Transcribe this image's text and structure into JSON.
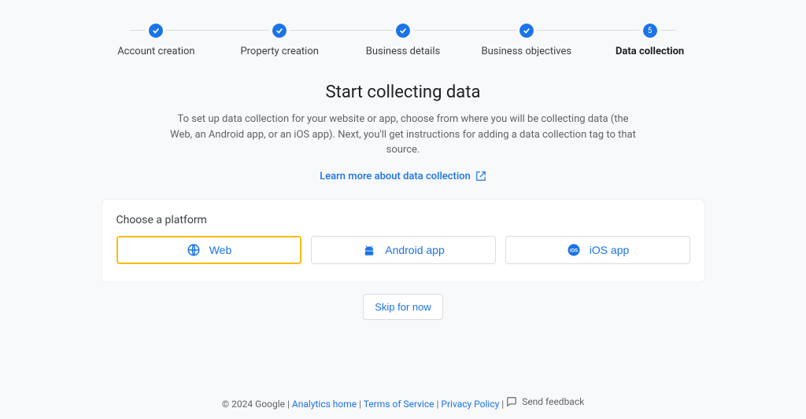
{
  "stepper": {
    "items": [
      {
        "label": "Account creation",
        "state": "done"
      },
      {
        "label": "Property creation",
        "state": "done"
      },
      {
        "label": "Business details",
        "state": "done"
      },
      {
        "label": "Business objectives",
        "state": "done"
      },
      {
        "label": "Data collection",
        "state": "current",
        "num": "5"
      }
    ]
  },
  "main": {
    "heading": "Start collecting data",
    "description": "To set up data collection for your website or app, choose from where you will be collecting data (the Web, an Android app, or an iOS app). Next, you'll get instructions for adding a data collection tag to that source.",
    "learn_more": "Learn more about data collection"
  },
  "card": {
    "title": "Choose a platform",
    "platforms": {
      "web": "Web",
      "android": "Android app",
      "ios": "iOS app"
    }
  },
  "skip": {
    "label": "Skip for now"
  },
  "footer": {
    "copyright": "© 2024 Google",
    "analytics_home": "Analytics home",
    "terms": "Terms of Service",
    "privacy": "Privacy Policy",
    "feedback": "Send feedback"
  }
}
